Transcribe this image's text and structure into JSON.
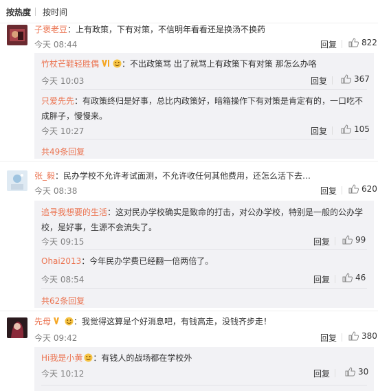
{
  "sort": {
    "hot": "按热度",
    "time": "按时间"
  },
  "comments": [
    {
      "user": "子褒老豆",
      "text": "：上有政策，下有对策，不信明年看看还是换汤不换药",
      "time": "今天 08:44",
      "reply_label": "回复",
      "likes": "822",
      "replies": [
        {
          "user": "竹杖芒鞋轻胜偶",
          "text": "：不出政策骂 出了就骂上有政策下有对策 那怎么办咯",
          "time": "今天 10:03",
          "reply_label": "回复",
          "likes": "367"
        },
        {
          "user": "只爱先先",
          "text": "：有政策终归是好事，总比内政策好，暗箱操作下有对策是肯定有的，一口吃不成胖子，慢慢来。",
          "time": "今天 10:27",
          "reply_label": "回复",
          "likes": "105"
        }
      ],
      "more": "共49条回复"
    },
    {
      "user": "张_毅",
      "text": "：民办学校不允许考试面测，不允许收任何其他费用，还怎么活下去…",
      "time": "今天 08:38",
      "reply_label": "回复",
      "likes": "620",
      "replies": [
        {
          "user": "追寻我想要的生活",
          "text": "：这对民办学校确实是致命的打击，对公办学校，特别是一般的公办学校，是好事，生源不会流失了。",
          "time": "今天 09:15",
          "reply_label": "回复",
          "likes": "99"
        },
        {
          "user": "Ohai2013",
          "text": "：今年民办学费已经翻一倍两倍了。",
          "time": "今天 08:54",
          "reply_label": "回复",
          "likes": "46"
        }
      ],
      "more": "共62条回复"
    },
    {
      "user": "先母",
      "text": "：我觉得这算是个好消息吧，有钱高走，没钱齐步走！",
      "time": "今天 09:42",
      "reply_label": "回复",
      "likes": "380",
      "replies": [
        {
          "user": "Hi我是小黄",
          "text": "：有钱人的战场都在学校外",
          "time": "今天 10:12",
          "reply_label": "回复",
          "likes": "30"
        }
      ]
    }
  ],
  "colors": {
    "username": "#eb7350",
    "reply_bg": "#f2f2f5",
    "time": "#808080",
    "vip": "#f5a623"
  }
}
